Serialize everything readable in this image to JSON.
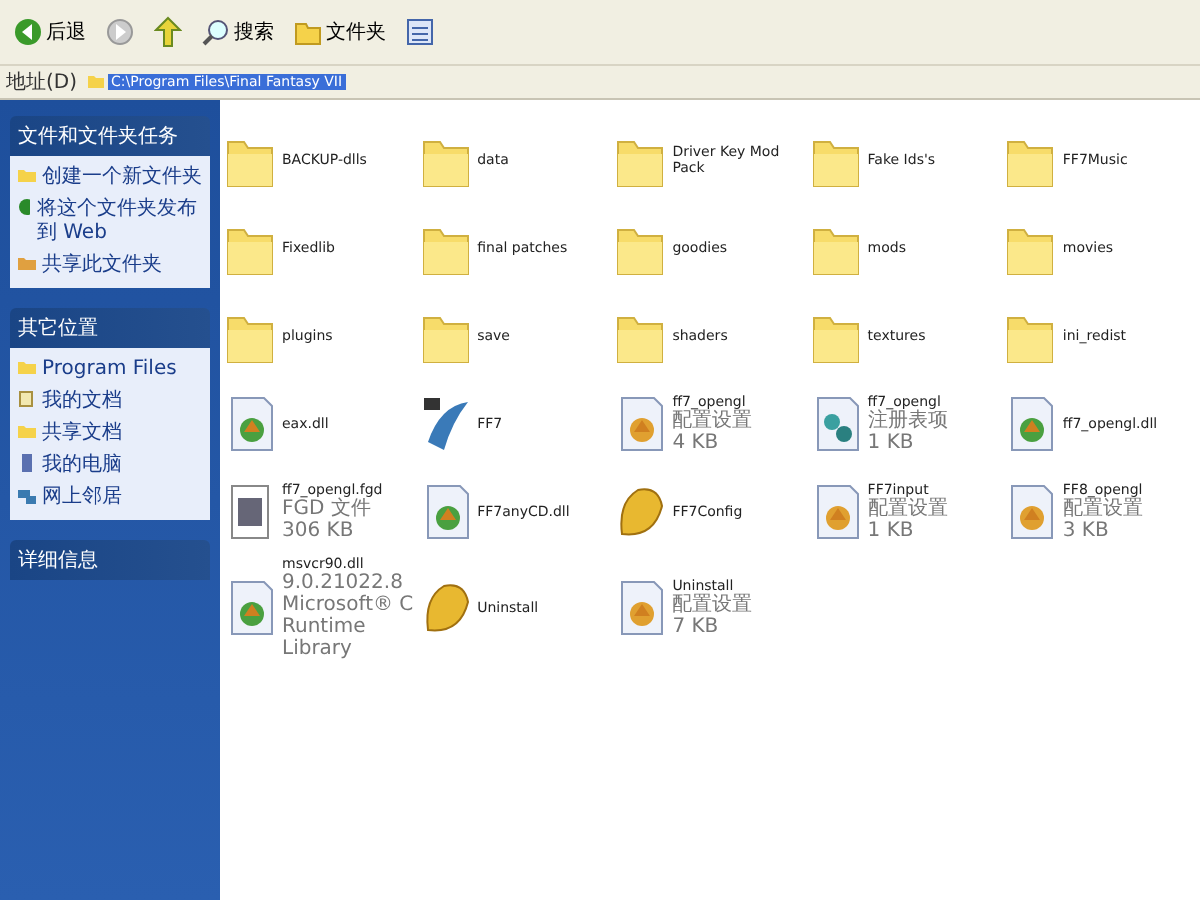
{
  "toolbar": {
    "buttons": [
      {
        "kind": "back",
        "label": "后退"
      },
      {
        "kind": "forward"
      },
      {
        "kind": "up"
      },
      {
        "kind": "search",
        "label": "搜索"
      },
      {
        "kind": "folders",
        "label": "文件夹"
      },
      {
        "kind": "views"
      }
    ]
  },
  "address": {
    "label": "地址(D)",
    "value": "C:\\Program Files\\Final Fantasy VII"
  },
  "sidebar": {
    "panels": [
      {
        "title": "文件和文件夹任务",
        "items": [
          {
            "kind": "newfolder",
            "label": "创建一个新文件夹"
          },
          {
            "kind": "web",
            "label": "将这个文件夹发布到 Web"
          },
          {
            "kind": "share",
            "label": "共享此文件夹"
          }
        ]
      },
      {
        "title": "其它位置",
        "items": [
          {
            "kind": "folder",
            "label": "Program Files"
          },
          {
            "kind": "docs",
            "label": "我的文档"
          },
          {
            "kind": "folder",
            "label": "共享文档"
          },
          {
            "kind": "computer",
            "label": "我的电脑"
          },
          {
            "kind": "network",
            "label": "网上邻居"
          }
        ]
      },
      {
        "title": "详细信息"
      }
    ]
  },
  "files": [
    {
      "kind": "folder",
      "name": "BACKUP-dlls"
    },
    {
      "kind": "folder",
      "name": "data"
    },
    {
      "kind": "folder",
      "name": "Driver Key Mod Pack"
    },
    {
      "kind": "folder",
      "name": "Fake Ids's"
    },
    {
      "kind": "folder",
      "name": "FF7Music"
    },
    {
      "kind": "folder",
      "name": "Fixedlib"
    },
    {
      "kind": "folder",
      "name": "final patches"
    },
    {
      "kind": "folder",
      "name": "goodies"
    },
    {
      "kind": "folder",
      "name": "mods"
    },
    {
      "kind": "folder",
      "name": "movies"
    },
    {
      "kind": "folder",
      "name": "plugins"
    },
    {
      "kind": "folder",
      "name": "save"
    },
    {
      "kind": "folder",
      "name": "shaders"
    },
    {
      "kind": "folder",
      "name": "textures"
    },
    {
      "kind": "folder",
      "name": "ini_redist"
    },
    {
      "kind": "dll",
      "name": "eax.dll"
    },
    {
      "kind": "ff7",
      "name": "FF7"
    },
    {
      "kind": "ini",
      "name": "ff7_opengl",
      "details": [
        "配置设置",
        "4 KB"
      ]
    },
    {
      "kind": "reg",
      "name": "ff7_opengl",
      "details": [
        "注册表项",
        "1 KB"
      ]
    },
    {
      "kind": "dll",
      "name": "ff7_opengl.dll"
    },
    {
      "kind": "fgd",
      "name": "ff7_opengl.fgd",
      "details": [
        "FGD 文件",
        "306 KB"
      ]
    },
    {
      "kind": "dll",
      "name": "FF7anyCD.dll"
    },
    {
      "kind": "chocobo",
      "name": "FF7Config"
    },
    {
      "kind": "ini",
      "name": "FF7input",
      "details": [
        "配置设置",
        "1 KB"
      ]
    },
    {
      "kind": "ini",
      "name": "FF8_opengl",
      "details": [
        "配置设置",
        "3 KB"
      ]
    },
    {
      "kind": "dll",
      "name": "msvcr90.dll",
      "details": [
        "9.0.21022.8",
        "Microsoft® C Runtime Library"
      ]
    },
    {
      "kind": "chocobo",
      "name": "Uninstall"
    },
    {
      "kind": "ini",
      "name": "Uninstall",
      "details": [
        "配置设置",
        "7 KB"
      ]
    }
  ]
}
